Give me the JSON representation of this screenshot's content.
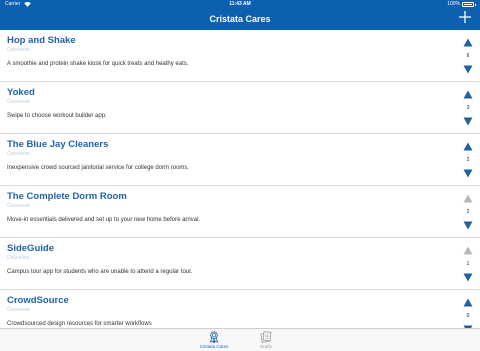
{
  "status_bar": {
    "carrier": "Carrier",
    "time": "11:43 AM",
    "battery": "100%"
  },
  "nav": {
    "title": "Cristata Cares",
    "add_icon": "plus-icon"
  },
  "items": [
    {
      "title": "Hop and Shake",
      "category": "Consumer",
      "description": "A smoothie and protein shake kiosk for quick treats and heathy eats.",
      "votes": "6",
      "up_active": true
    },
    {
      "title": "Yoked",
      "category": "Consumer",
      "description": "Swipe to choose workout builder app.",
      "votes": "3",
      "up_active": true
    },
    {
      "title": "The Blue Jay Cleaners",
      "category": "Consumer",
      "description": "Inexpensive crowd sourced janitorial service for college dorm rooms.",
      "votes": "2",
      "up_active": true
    },
    {
      "title": "The Complete Dorm Room",
      "category": "Consumer",
      "description": "Move-in essentials delivered and set up to your new home before arrival.",
      "votes": "2",
      "up_active": false
    },
    {
      "title": "SideGuide",
      "category": "Education",
      "description": "Campus tour app for students who are unable to attend a regular tour.",
      "votes": "1",
      "up_active": false
    },
    {
      "title": "CrowdSource",
      "category": "Consumer",
      "description": "Crowdsourced design resources for smarter workflows",
      "votes": "0",
      "up_active": true
    }
  ],
  "tabs": [
    {
      "label": "Cristata Cares",
      "icon": "badge-icon",
      "selected": true
    },
    {
      "label": "Drafts",
      "icon": "drafts-icon",
      "selected": false
    }
  ],
  "colors": {
    "nav_blue": "#0d5fb0",
    "title_blue": "#1f63a8",
    "arrow_active": "#1f5fa3",
    "arrow_inactive": "#b8b8b8"
  }
}
